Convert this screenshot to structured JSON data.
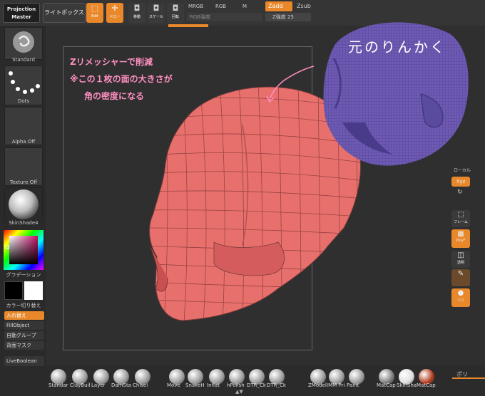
{
  "topbar": {
    "projection_master_line1": "Projection",
    "projection_master_line2": "Master",
    "lightbox": "ライトボックス",
    "edit_label": "Edit",
    "draw_label": "ドロー",
    "move_label": "移動",
    "scale_label": "スケール",
    "rotate_label": "回転",
    "mrgb": "MRGB",
    "rgb": "RGB",
    "m": "M",
    "rgb_intensity": "RGB強度",
    "zadd": "Zadd",
    "zsub": "Zsub",
    "z_intensity": "Z強度 25"
  },
  "leftpanel": {
    "brush_label": "Standard",
    "stroke_label": "Dots",
    "alpha_label": "Alpha Off",
    "texture_label": "Texture Off",
    "material_label": "SkinShade4",
    "gradient_label": "グラデーション",
    "switch_color_label": "カラー切り替え",
    "swap_label": "入れ替え",
    "fill_object": "FillObject",
    "auto_group": "自動グループ",
    "backface_mask": "背面マスク",
    "live_boolean": "LiveBoolean"
  },
  "annotations": {
    "line1": "Zリメッシャーで削減",
    "line2": "※この１枚の面の大きさが",
    "line3": "角の密度になる",
    "head_label": "元のりんかく"
  },
  "rightpanel": {
    "top_label": "ローカル",
    "xyz": "Xyz",
    "frame": "フレーム",
    "polyf": "PolyF",
    "transparent": "透明",
    "solo": "ソロ"
  },
  "shelf": {
    "brushes": [
      "Standar",
      "ClayBuil",
      "Layer",
      "DamSta",
      "Chisel",
      "Move",
      "SnakeH",
      "Inflat",
      "hPolish",
      "DTR_Ck",
      "DTR_Ck",
      "ZModel",
      "IMM Pri",
      "Paint",
      "MatCap",
      "SkinSha",
      "MatCap"
    ],
    "right_text": "ポリ"
  },
  "colors": {
    "accent": "#e8882a",
    "mesh_fill": "#e86a6a",
    "original_mesh": "#6e5ab4",
    "annotation": "#ff8fc2"
  }
}
